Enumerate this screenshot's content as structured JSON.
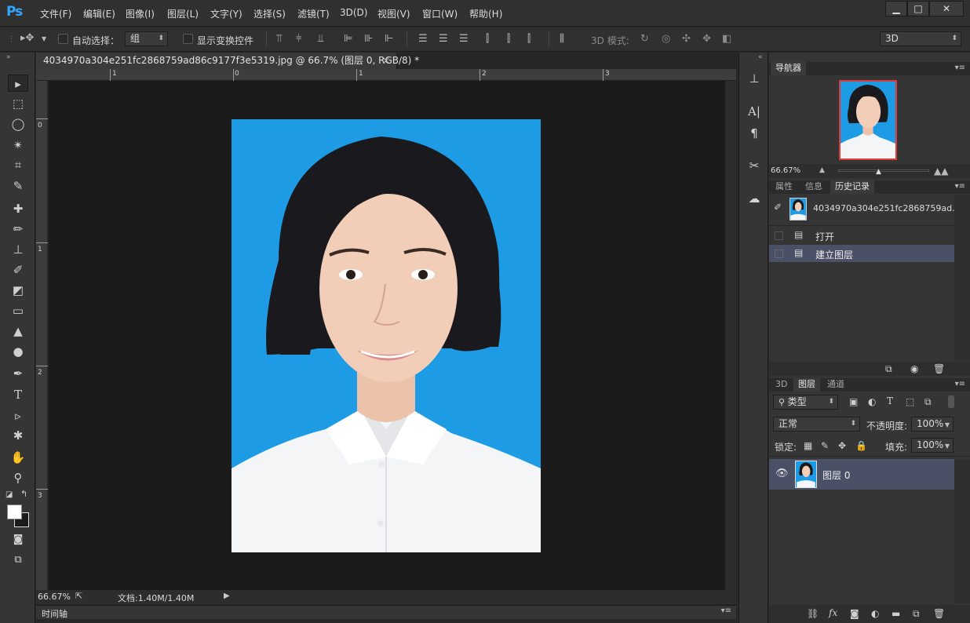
{
  "app": {
    "logo": "Ps"
  },
  "menu": [
    "文件(F)",
    "编辑(E)",
    "图像(I)",
    "图层(L)",
    "文字(Y)",
    "选择(S)",
    "滤镜(T)",
    "3D(D)",
    "视图(V)",
    "窗口(W)",
    "帮助(H)"
  ],
  "window_controls": {
    "minimize": "▁",
    "maximize": "□",
    "close": "✕"
  },
  "options": {
    "auto_select_label": "自动选择：",
    "auto_select_value": "组",
    "show_transform_label": "显示变换控件",
    "mode_3d_label": "3D 模式:",
    "workspace_value": "3D"
  },
  "document": {
    "tab_title": "4034970a304e251fc2868759ad86c9177f3e5319.jpg @ 66.7% (图层 0, RGB/8) *",
    "tab_close": "×",
    "ruler_h": [
      "1",
      "0",
      "1",
      "2",
      "3"
    ],
    "ruler_v": [
      "0",
      "1",
      "2",
      "3"
    ],
    "zoom": "66.67%",
    "doc_size": "文档:1.40M/1.40M"
  },
  "timeline": {
    "label": "时间轴"
  },
  "navigator": {
    "tab": "导航器",
    "zoom": "66.67%"
  },
  "history_panel": {
    "tabs": [
      "属性",
      "信息",
      "历史记录"
    ],
    "snapshot_name": "4034970a304e251fc2868759ad...",
    "entries": [
      "打开",
      "建立图层"
    ]
  },
  "layers_panel": {
    "tabs": [
      "3D",
      "图层",
      "通道"
    ],
    "filter_type": "类型",
    "blend_mode": "正常",
    "opacity_label": "不透明度:",
    "opacity_value": "100%",
    "lock_label": "锁定:",
    "fill_label": "填充:",
    "fill_value": "100%",
    "layers": [
      {
        "name": "图层 0",
        "visible": true
      }
    ]
  },
  "colors": {
    "accent_blue": "#31a8ff",
    "photo_bg": "#1e9be5",
    "selected_row": "#4a5066"
  }
}
